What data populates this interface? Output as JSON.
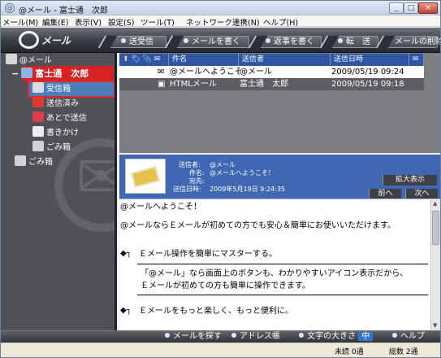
{
  "window": {
    "title": "@メール - 富士通　次郎",
    "app_icon": "@"
  },
  "menu": [
    "メール(M)",
    "編集(E)",
    "表示(V)",
    "設定(S)",
    "ツール(T)",
    "ネットワーク連携(N)",
    "ヘルプ(H)"
  ],
  "toolbar": {
    "logo": "メール",
    "buttons": [
      "送受信",
      "メールを書く",
      "返事を書く",
      "転　送",
      "メールの削除"
    ]
  },
  "sidebar": {
    "root": "@メール",
    "user": "富士通　次郎",
    "folders": [
      "受信箱",
      "送信済み",
      "あとで送信",
      "書きかけ",
      "ごみ箱"
    ],
    "trash": "ごみ箱"
  },
  "list": {
    "headers": [
      "件名",
      "送信者",
      "送信日時"
    ],
    "rows": [
      {
        "subject": "@メールへようこそ！",
        "sender": "@メール",
        "date": "2009/05/19 09:24"
      },
      {
        "subject": "HTMLメール",
        "sender": "富士通　太郎",
        "date": "2009/05/19 09:18"
      }
    ]
  },
  "preview": {
    "sender_label": "送信者:",
    "sender": "@メール",
    "subject_label": "件名:",
    "subject": "@メールへようこそ！",
    "to_label": "宛先:",
    "to": "",
    "date_label": "送信日時:",
    "date": "2009年5月19日 9:24:35",
    "enlarge": "拡大表示",
    "prev": "前へ",
    "next": "次へ"
  },
  "body": [
    "@メールへようこそ！",
    "@メールならＥメールが初めての方でも安心＆簡単にお使いいただけます。",
    "Ｅメール操作を簡単にマスターする。",
    "「@メール」なら画面上のボタンも、わかりやすいアイコン表示だから、",
    "Ｅメールが初めての方も簡単に操作できます。",
    "Ｅメールをもっと楽しく、もっと便利に。"
  ],
  "bottom": {
    "search": "メールを探す",
    "address": "アドレス帳",
    "text_size": "文字の大きさ",
    "text_size_value": "中",
    "help": "ヘルプ"
  },
  "status": {
    "unread": "未読 0通",
    "total": "総数 2通"
  },
  "colors": {
    "selection": "#d62222",
    "accent": "#3f67b2"
  }
}
